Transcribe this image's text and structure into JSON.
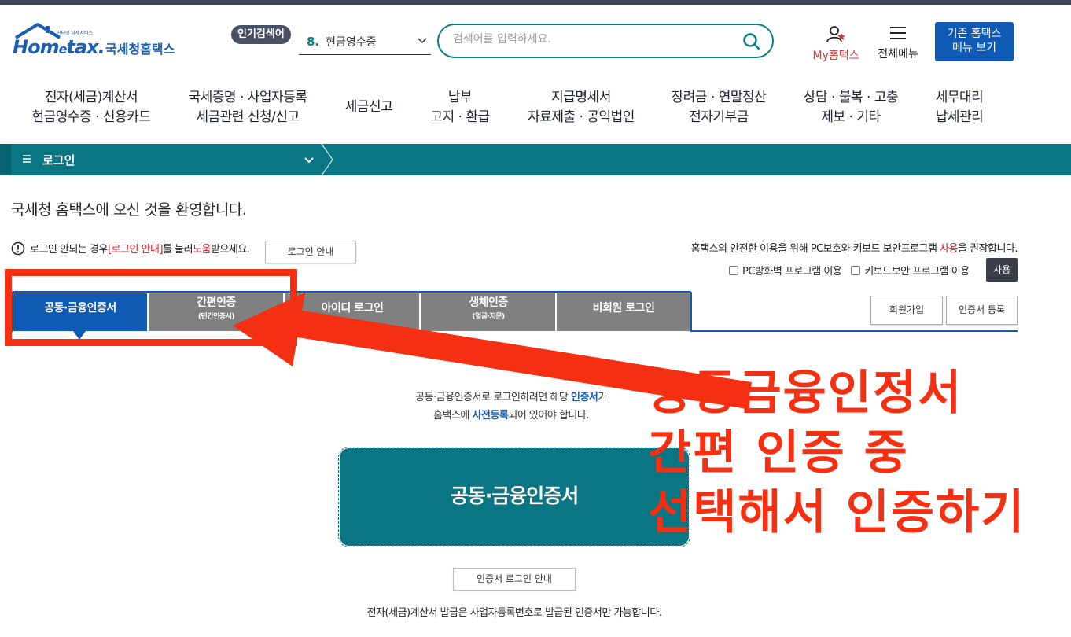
{
  "header": {
    "logo_tagline": "인터넷 납세서비스",
    "logo_main": "Hom",
    "logo_e": "e",
    "logo_tail": "tax.",
    "logo_sub": "국세청홈택스",
    "popular_badge": "인기검색어",
    "popular_rank": "8.",
    "popular_term": "현금영수증",
    "search_placeholder": "검색어를 입력하세요.",
    "my_hometax": "My홈택스",
    "all_menu": "전체메뉴",
    "old_menu_line1": "기존 홈택스",
    "old_menu_line2": "메뉴 보기"
  },
  "nav": [
    {
      "line1": "전자(세금)계산서",
      "line2": "현금영수증 · 신용카드"
    },
    {
      "line1": "국세증명 · 사업자등록",
      "line2": "세금관련 신청/신고"
    },
    {
      "line1": "세금신고",
      "line2": ""
    },
    {
      "line1": "납부",
      "line2": "고지 · 환급"
    },
    {
      "line1": "지급명세서",
      "line2": "자료제출 · 공익법인"
    },
    {
      "line1": "장려금 · 연말정산",
      "line2": "전자기부금"
    },
    {
      "line1": "상담 · 불복 · 고충",
      "line2": "제보 · 기타"
    },
    {
      "line1": "세무대리",
      "line2": "납세관리"
    }
  ],
  "breadcrumb": {
    "label": "로그인"
  },
  "welcome": "국세청 홈택스에 오신 것을 환영합니다.",
  "notice": {
    "part1": "로그인 안되는 경우 ",
    "link": "[로그인 안내]",
    "part2": "를 눌러 ",
    "help": "도움",
    "part3": "받으세요.",
    "button": "로그인 안내"
  },
  "security": {
    "note_part1": "홈택스의 안전한 이용을 위해 PC보호와 키보드 보안프로그램 ",
    "note_use": "사용",
    "note_part2": "을 권장합니다.",
    "firewall": "PC방화벽 프로그램 이용",
    "keyboard": "키보드보안 프로그램 이용",
    "use_button": "사용"
  },
  "tabs": [
    {
      "label": "공동·금융인증서",
      "sub": ""
    },
    {
      "label": "간편인증",
      "sub": "(민간인증서)"
    },
    {
      "label": "아이디 로그인",
      "sub": ""
    },
    {
      "label": "생체인증",
      "sub": "(얼굴·지문)"
    },
    {
      "label": "비회원 로그인",
      "sub": ""
    }
  ],
  "side_buttons": {
    "join": "회원가입",
    "cert_register": "인증서 등록"
  },
  "info": {
    "line1_a": "공동·금융인증서로 로그인하려면 해당 ",
    "line1_b": "인증서",
    "line1_c": "가",
    "line2_a": "홈택스에 ",
    "line2_b": "사전등록",
    "line2_c": "되어 있어야 합니다."
  },
  "cert_button": "공동·금융인증서",
  "cert_guide_button": "인증서 로그인 안내",
  "footer_note": "전자(세금)계산서 발급은 사업자등록번호로 발급된 인증서만 가능합니다.",
  "annotation": {
    "line1": "공동금융인정서",
    "line2": "간편 인증 중",
    "line3": "선택해서 인증하기"
  },
  "colors": {
    "teal": "#0a7683",
    "blue": "#0f5ab4",
    "annotation_red": "#f42f12",
    "tab_gray": "#808080"
  }
}
